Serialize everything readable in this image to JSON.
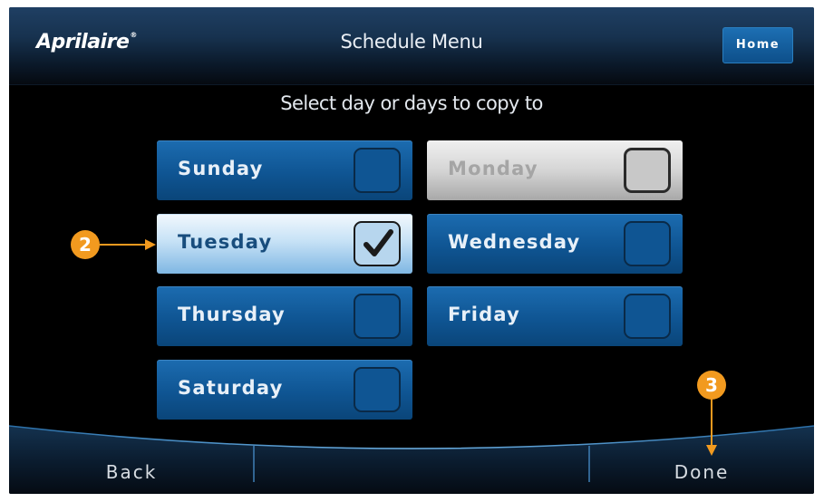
{
  "header": {
    "logo": "Aprilaire",
    "logo_mark": "®",
    "title": "Schedule Menu",
    "home_label": "Home"
  },
  "subtitle": "Select day or days to copy to",
  "days": [
    {
      "label": "Sunday",
      "checked": false,
      "state": "normal"
    },
    {
      "label": "Monday",
      "checked": false,
      "state": "disabled"
    },
    {
      "label": "Tuesday",
      "checked": true,
      "state": "selected"
    },
    {
      "label": "Wednesday",
      "checked": false,
      "state": "normal"
    },
    {
      "label": "Thursday",
      "checked": false,
      "state": "normal"
    },
    {
      "label": "Friday",
      "checked": false,
      "state": "normal"
    },
    {
      "label": "Saturday",
      "checked": false,
      "state": "normal"
    }
  ],
  "footer": {
    "back_label": "Back",
    "done_label": "Done"
  },
  "callouts": [
    {
      "label": "2",
      "target": "Tuesday"
    },
    {
      "label": "3",
      "target": "Done"
    }
  ],
  "colors": {
    "accent_blue": "#0f5593",
    "callout_orange": "#f29a1f",
    "background": "#000000"
  }
}
